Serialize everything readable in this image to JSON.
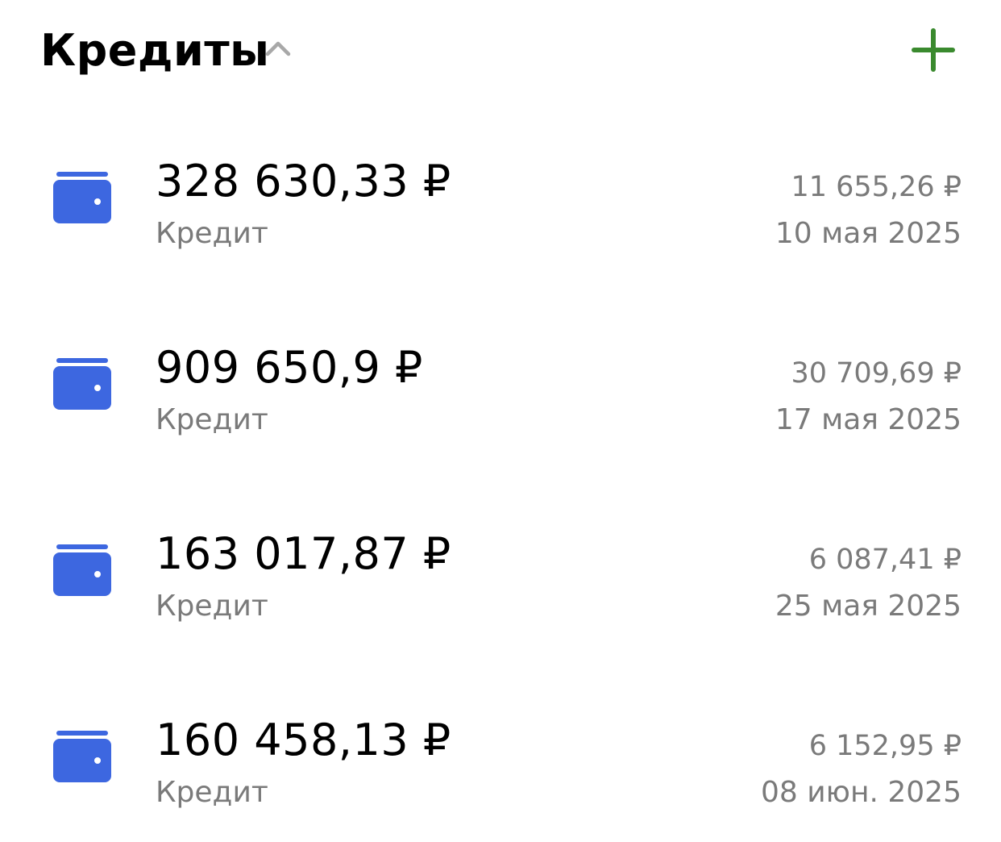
{
  "header": {
    "title": "Кредиты",
    "chevron_icon": "chevron-up-icon",
    "add_icon": "plus-icon",
    "add_color": "#3a8a2e"
  },
  "wallet_icon": {
    "name": "wallet-icon",
    "color": "#3d67e0"
  },
  "loans": [
    {
      "amount": "328 630,33 ₽",
      "label": "Кредит",
      "payment": "11 655,26 ₽",
      "date": "10 мая 2025"
    },
    {
      "amount": "909 650,9 ₽",
      "label": "Кредит",
      "payment": "30 709,69 ₽",
      "date": "17 мая 2025"
    },
    {
      "amount": "163 017,87 ₽",
      "label": "Кредит",
      "payment": "6 087,41 ₽",
      "date": "25 мая 2025"
    },
    {
      "amount": "160 458,13 ₽",
      "label": "Кредит",
      "payment": "6 152,95 ₽",
      "date": "08 июн. 2025"
    }
  ]
}
